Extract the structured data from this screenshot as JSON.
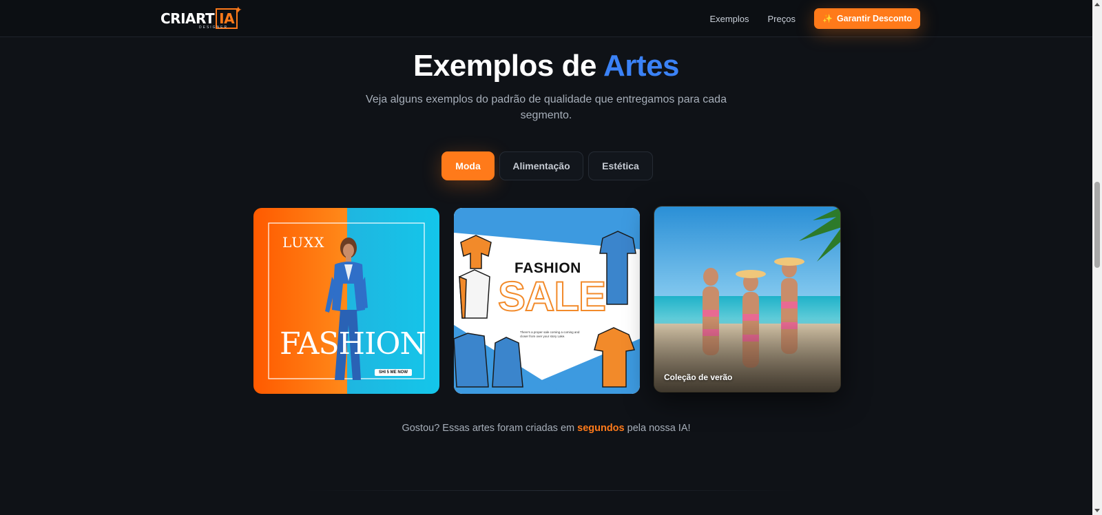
{
  "header": {
    "logo": {
      "cri": "CRI",
      "art": "ART",
      "ia": "IA",
      "sub": "DESIGNER"
    },
    "nav": [
      {
        "label": "Exemplos"
      },
      {
        "label": "Preços"
      }
    ],
    "cta_label": "Garantir Desconto",
    "cta_icon": "sparkles-icon"
  },
  "hero": {
    "title_main": "Exemplos de ",
    "title_accent": "Artes",
    "subtitle": "Veja alguns exemplos do padrão de qualidade que entregamos para cada segmento."
  },
  "tabs": [
    {
      "label": "Moda",
      "active": true
    },
    {
      "label": "Alimentação",
      "active": false
    },
    {
      "label": "Estética",
      "active": false
    }
  ],
  "cards": [
    {
      "brand": "LUXX",
      "headline": "FASHION",
      "tag": "SHI 5 ME NOW"
    },
    {
      "top": "FASHION",
      "headline": "SALE",
      "body": "There's a proper sale coming a coming and closer from over your story Lake."
    },
    {
      "caption": "Coleção de verão"
    }
  ],
  "footer_note": {
    "before": "Gostou? Essas artes foram criadas em ",
    "highlight": "segundos",
    "after": " pela nossa IA!"
  },
  "colors": {
    "accent": "#ff7a1a",
    "title_accent": "#3b82f6",
    "background": "#0f1217"
  }
}
